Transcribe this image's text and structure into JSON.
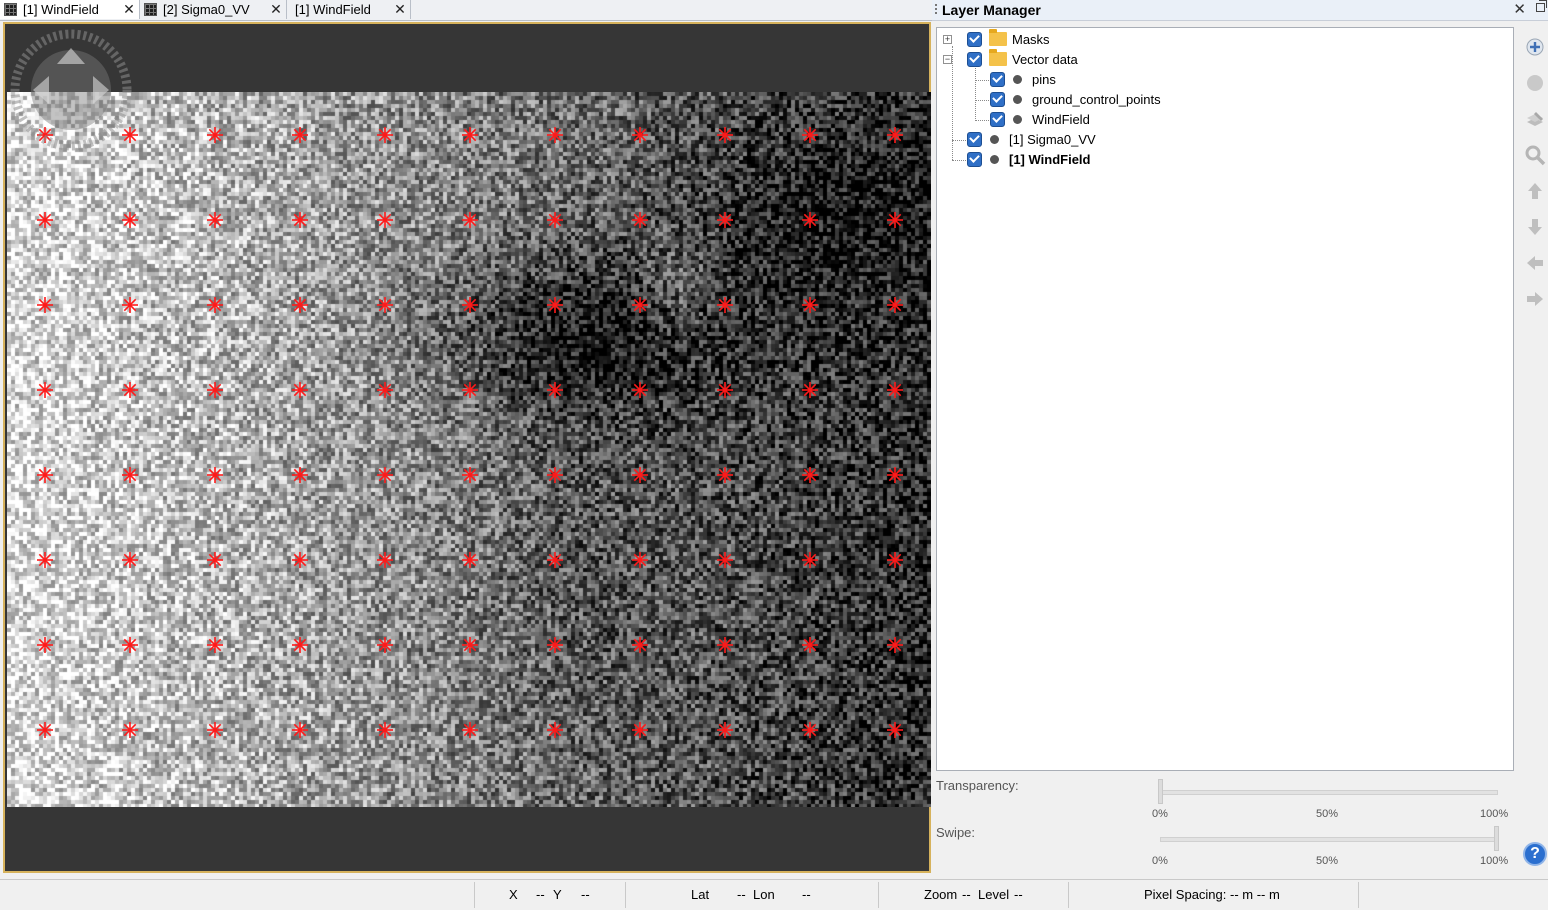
{
  "tabs": [
    {
      "label": "[1] WindField",
      "active": true
    },
    {
      "label": "[2] Sigma0_VV",
      "active": false
    },
    {
      "label": "[1] WindField",
      "active": false
    }
  ],
  "tab_close_glyph": "✕",
  "view": {
    "raster": "WindField",
    "marker_color": "#ff1a1a",
    "marker_grid": {
      "rows": 8,
      "cols": 11
    }
  },
  "layer_manager": {
    "title": "Layer Manager",
    "close_glyph": "✕",
    "items": [
      {
        "label": "Masks",
        "icon": "folder-icon",
        "checked": true,
        "expander": "+"
      },
      {
        "label": "Vector data",
        "icon": "folder-icon",
        "checked": true,
        "expander": "−"
      },
      {
        "label": "pins",
        "icon": "vector-layer-icon",
        "checked": true
      },
      {
        "label": "ground_control_points",
        "icon": "vector-layer-icon",
        "checked": true
      },
      {
        "label": "WindField",
        "icon": "vector-layer-icon",
        "checked": true
      },
      {
        "label": "[1] Sigma0_VV",
        "icon": "raster-layer-icon",
        "checked": true
      },
      {
        "label": "[1] WindField",
        "icon": "raster-layer-icon",
        "checked": true,
        "bold": true
      }
    ],
    "transparency": {
      "label": "Transparency:",
      "value_percent": 0,
      "ticks": [
        "0%",
        "50%",
        "100%"
      ]
    },
    "swipe": {
      "label": "Swipe:",
      "value_percent": 100,
      "ticks": [
        "0%",
        "50%",
        "100%"
      ]
    },
    "tools": [
      "add-layer-icon",
      "remove-layer-icon",
      "layer-editor-icon",
      "zoom-to-layer-icon",
      "move-up-icon",
      "move-down-icon",
      "move-left-icon",
      "move-right-icon"
    ],
    "help_glyph": "?"
  },
  "status": {
    "x_label": "X",
    "x_value": "--",
    "y_label": "Y",
    "y_value": "--",
    "lat_label": "Lat",
    "lat_value": "--",
    "lon_label": "Lon",
    "lon_value": "--",
    "zoom_label": "Zoom",
    "zoom_value": "--",
    "level_label": "Level",
    "level_value": "--",
    "pixel_spacing": "Pixel Spacing: -- m -- m"
  }
}
